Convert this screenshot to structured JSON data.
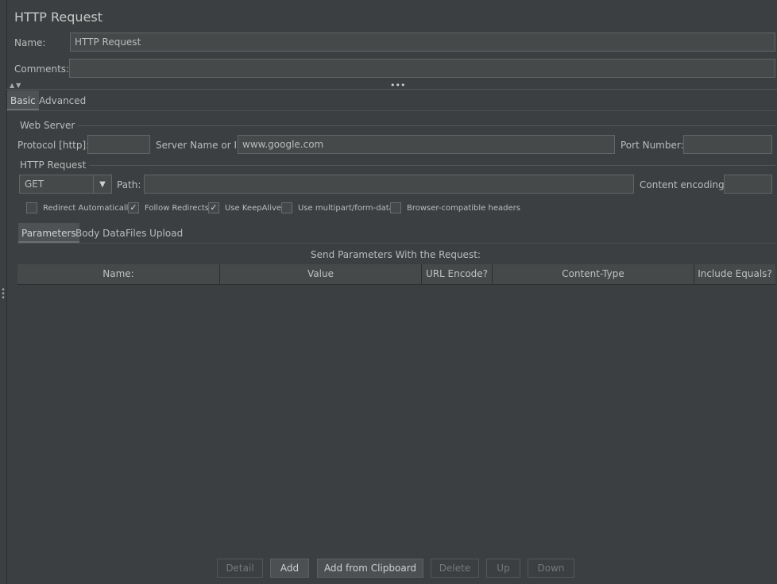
{
  "title": "HTTP Request",
  "name_label": "Name:",
  "name_value": "HTTP Request",
  "comments_label": "Comments:",
  "comments_value": "",
  "top_tabs": [
    {
      "label": "Basic",
      "active": true
    },
    {
      "label": "Advanced",
      "active": false
    }
  ],
  "web_server": {
    "title": "Web Server",
    "protocol_label": "Protocol [http]:",
    "protocol_value": "",
    "server_label": "Server Name or IP:",
    "server_value": "www.google.com",
    "port_label": "Port Number:",
    "port_value": ""
  },
  "http_request": {
    "title": "HTTP Request",
    "method": "GET",
    "path_label": "Path:",
    "path_value": "",
    "encoding_label": "Content encoding:",
    "encoding_value": ""
  },
  "checkboxes": [
    {
      "label": "Redirect Automatically",
      "checked": false
    },
    {
      "label": "Follow Redirects",
      "checked": true
    },
    {
      "label": "Use KeepAlive",
      "checked": true
    },
    {
      "label": "Use multipart/form-data",
      "checked": false
    },
    {
      "label": "Browser-compatible headers",
      "checked": false
    }
  ],
  "param_tabs": [
    {
      "label": "Parameters",
      "active": true
    },
    {
      "label": "Body Data",
      "active": false
    },
    {
      "label": "Files Upload",
      "active": false
    }
  ],
  "table": {
    "caption": "Send Parameters With the Request:",
    "columns": [
      "Name:",
      "Value",
      "URL Encode?",
      "Content-Type",
      "Include Equals?"
    ]
  },
  "buttons": [
    {
      "label": "Detail",
      "enabled": false
    },
    {
      "label": "Add",
      "enabled": true
    },
    {
      "label": "Add from Clipboard",
      "enabled": true
    },
    {
      "label": "Delete",
      "enabled": false
    },
    {
      "label": "Up",
      "enabled": false
    },
    {
      "label": "Down",
      "enabled": false
    }
  ],
  "icons": {
    "splitter_arrows": "collapse-expand-arrows-icon",
    "splitter_handle": "drag-handle-icon",
    "dropdown": "chevron-down-icon",
    "check": "checkmark-icon"
  }
}
